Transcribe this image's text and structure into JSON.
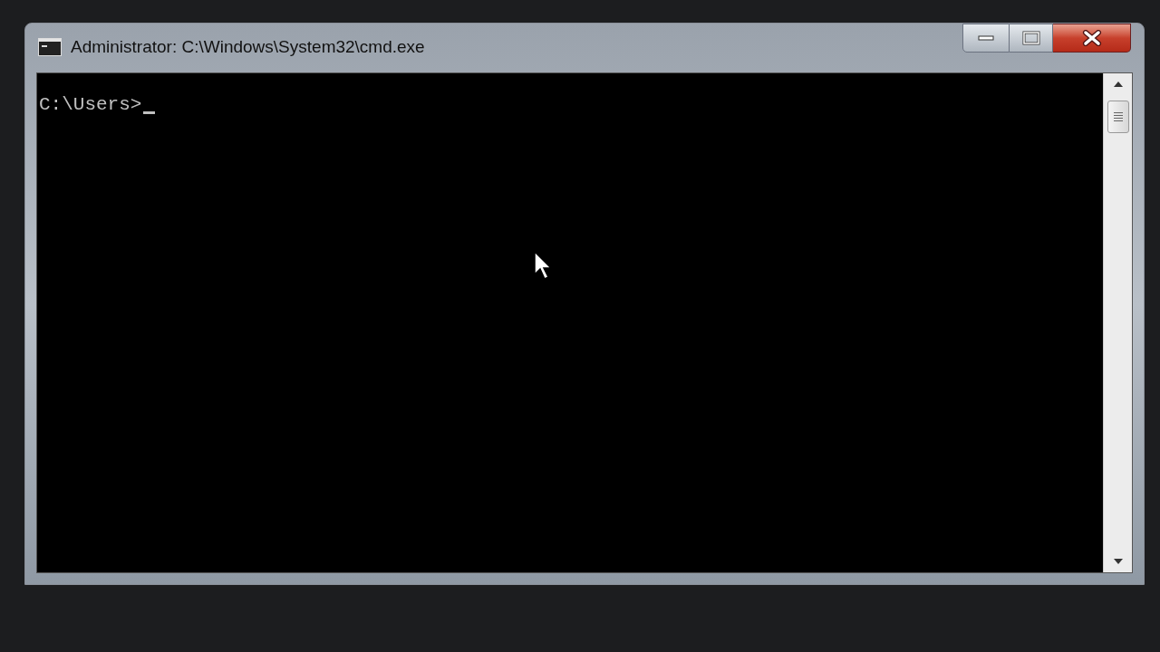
{
  "window": {
    "title": "Administrator: C:\\Windows\\System32\\cmd.exe"
  },
  "console": {
    "lines": [
      "C:\\Users>"
    ],
    "cursor": true
  }
}
